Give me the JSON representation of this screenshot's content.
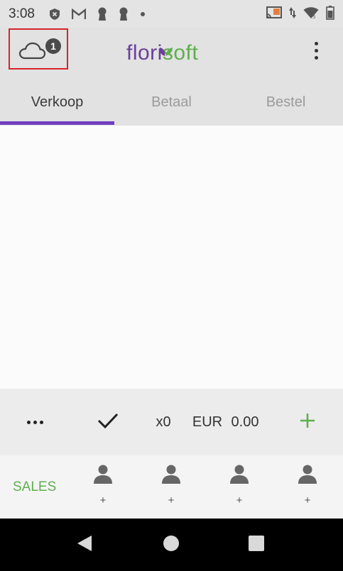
{
  "status_bar": {
    "time": "3:08",
    "left_icons": [
      "shield-x-icon",
      "gmail-icon",
      "keyhole-icon",
      "keyhole-icon",
      "dot-icon"
    ],
    "right_icons": [
      "cast-icon",
      "data-arrows-icon",
      "wifi-icon",
      "battery-icon"
    ]
  },
  "appbar": {
    "cloud_badge": "1",
    "logo_part1": "flori",
    "logo_part2": "soft",
    "accent_color": "#6f3fbf",
    "brand_green": "#5fae4e"
  },
  "tabs": [
    {
      "label": "Verkoop",
      "active": true
    },
    {
      "label": "Betaal",
      "active": false
    },
    {
      "label": "Bestel",
      "active": false
    }
  ],
  "summary": {
    "quantity": "x0",
    "currency": "EUR",
    "amount": "0.00"
  },
  "footer": {
    "sales_label": "SALES",
    "customers": [
      {
        "plus": "+"
      },
      {
        "plus": "+"
      },
      {
        "plus": "+"
      },
      {
        "plus": "+"
      }
    ]
  }
}
